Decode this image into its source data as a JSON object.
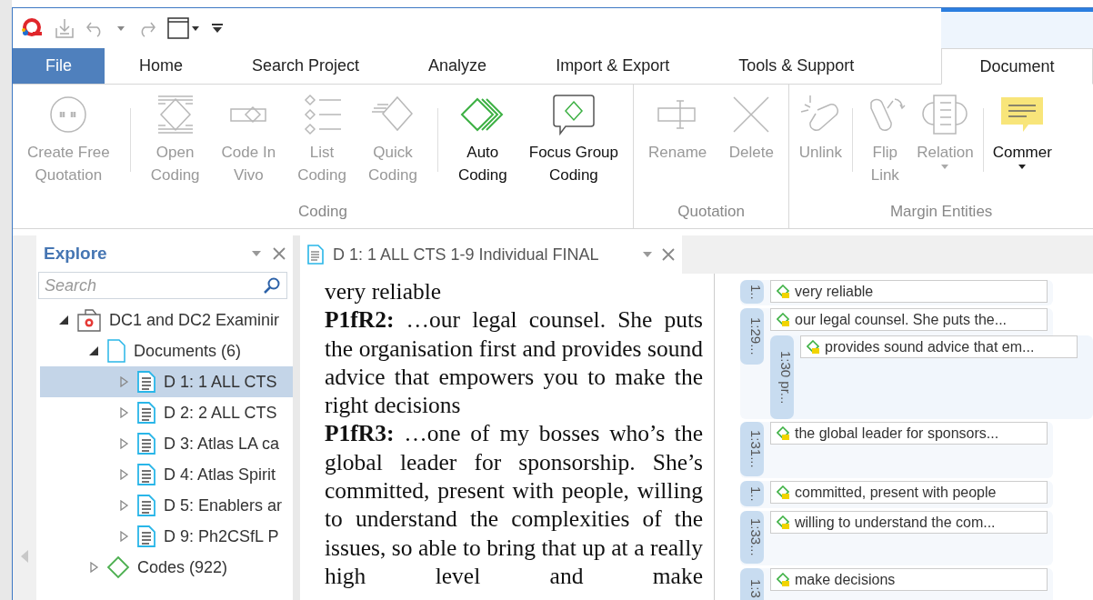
{
  "ribbon_tabs": [
    {
      "label": "File",
      "kind": "file",
      "selected": false
    },
    {
      "label": "Home",
      "kind": "tab",
      "selected": false
    },
    {
      "label": "Search Project",
      "kind": "tab",
      "selected": false
    },
    {
      "label": "Analyze",
      "kind": "tab",
      "selected": false
    },
    {
      "label": "Import & Export",
      "kind": "tab",
      "selected": false
    },
    {
      "label": "Tools & Support",
      "kind": "tab",
      "selected": false
    },
    {
      "label": "Document",
      "kind": "contextual",
      "selected": true
    }
  ],
  "ribbon_groups": [
    {
      "label": "Coding",
      "sections": [
        [
          {
            "label": "Create Free\nQuotation",
            "kind": "free-quotation",
            "disabled": true,
            "dropdown": false
          }
        ],
        [
          {
            "label": "Open\nCoding",
            "kind": "open-coding",
            "disabled": true,
            "dropdown": false
          },
          {
            "label": "Code In\nVivo",
            "kind": "in-vivo",
            "disabled": true,
            "dropdown": false
          },
          {
            "label": "List\nCoding",
            "kind": "list-coding",
            "disabled": true,
            "dropdown": false
          },
          {
            "label": "Quick\nCoding",
            "kind": "quick-coding",
            "disabled": true,
            "dropdown": false
          }
        ],
        [
          {
            "label": "Auto\nCoding",
            "kind": "auto-coding",
            "disabled": false,
            "dropdown": false
          },
          {
            "label": "Focus Group\nCoding",
            "kind": "focus-group",
            "disabled": false,
            "dropdown": false
          }
        ]
      ]
    },
    {
      "label": "Quotation",
      "sections": [
        [
          {
            "label": "Rename",
            "kind": "rename",
            "disabled": true,
            "dropdown": false
          },
          {
            "label": "Delete",
            "kind": "delete",
            "disabled": true,
            "dropdown": false
          }
        ]
      ]
    },
    {
      "label": "Margin Entities",
      "sections": [
        [
          {
            "label": "Unlink",
            "kind": "unlink",
            "disabled": true,
            "dropdown": false
          }
        ],
        [
          {
            "label": "Flip\nLink",
            "kind": "flip-link",
            "disabled": true,
            "dropdown": false
          },
          {
            "label": "Relation",
            "kind": "relation",
            "disabled": true,
            "dropdown": true
          }
        ],
        [
          {
            "label": "Commer",
            "kind": "comment",
            "disabled": false,
            "dropdown": true
          }
        ]
      ]
    }
  ],
  "explore_panel": {
    "title": "Explore",
    "search": {
      "placeholder": "Search"
    },
    "tree": [
      {
        "label": "DC1 and DC2 Examinir",
        "kind": "project",
        "expanded": true,
        "selected": false,
        "children": [
          {
            "label": "Documents (6)",
            "kind": "documents",
            "expanded": true,
            "selected": false,
            "children": [
              {
                "label": "D 1: 1 ALL CTS",
                "kind": "document",
                "expanded": false,
                "selected": true
              },
              {
                "label": "D 2: 2 ALL CTS",
                "kind": "document",
                "expanded": false,
                "selected": false
              },
              {
                "label": "D 3: Atlas LA ca",
                "kind": "document",
                "expanded": false,
                "selected": false
              },
              {
                "label": "D 4: Atlas Spirit",
                "kind": "document",
                "expanded": false,
                "selected": false
              },
              {
                "label": "D 5: Enablers ar",
                "kind": "document",
                "expanded": false,
                "selected": false
              },
              {
                "label": "D 9: Ph2CSfL P",
                "kind": "document",
                "expanded": false,
                "selected": false
              }
            ]
          },
          {
            "label": "Codes (922)",
            "kind": "codes",
            "expanded": false,
            "selected": false
          }
        ]
      }
    ]
  },
  "document_tab": {
    "title": "D 1: 1 ALL CTS 1-9 Individual FINAL"
  },
  "document_paragraphs": [
    "very reliable",
    "**P1fR2:** …our legal counsel. She puts the organisation first and provides sound advice that empowers you to make the right decisions",
    "**P1fR3:** …one of my bosses who’s the global leader for sponsorship. She’s committed, present with people, willing to understand the complexities of the issues, so able to bring that up at a really high level and make"
  ],
  "margin_groups": [
    {
      "label": "1..",
      "quotes": [
        "very reliable"
      ]
    },
    {
      "label": "1:29...",
      "quotes": [
        "our legal counsel. She puts the..."
      ],
      "children": [
        {
          "label": "1:30 pr...",
          "quotes": [
            "provides sound advice that em..."
          ]
        }
      ]
    },
    {
      "label": "1:31...",
      "quotes": [
        "the global leader for sponsors..."
      ]
    },
    {
      "label": "1..",
      "quotes": [
        "committed, present with people"
      ]
    },
    {
      "label": "1:33...",
      "quotes": [
        "willing to understand the com..."
      ]
    },
    {
      "label": "1:3",
      "quotes": [
        "make decisions"
      ]
    }
  ]
}
